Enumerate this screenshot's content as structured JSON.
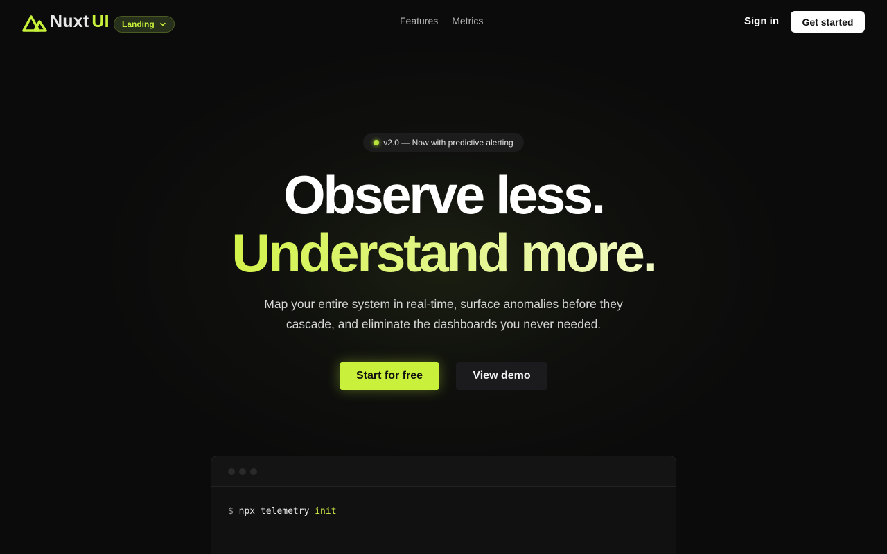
{
  "brand": {
    "name_part1": "Nuxt",
    "name_part2": "UI",
    "accent": "#c7f03a"
  },
  "template_select": {
    "value": "Landing"
  },
  "nav": {
    "items": [
      "Features",
      "Metrics"
    ]
  },
  "actions": {
    "signin": "Sign in",
    "get_started": "Get started"
  },
  "hero": {
    "badge": "v2.0 — Now with predictive alerting",
    "headline_line1": "Observe less.",
    "headline_line2": "Understand more.",
    "subtitle": "Map your entire system in real-time, surface anomalies before they cascade, and eliminate the dashboards you never needed.",
    "cta_primary": "Start for free",
    "cta_secondary": "View demo"
  },
  "terminal": {
    "prompt": "$",
    "command": "npx telemetry",
    "argument": "init"
  },
  "icons": {
    "logo": "nuxt-logo-icon",
    "dropdown": "chevron-down-icon",
    "status": "status-dot-icon"
  },
  "colors": {
    "background": "#0b0b0b",
    "accent": "#c9f03a",
    "text": "#ffffff"
  }
}
